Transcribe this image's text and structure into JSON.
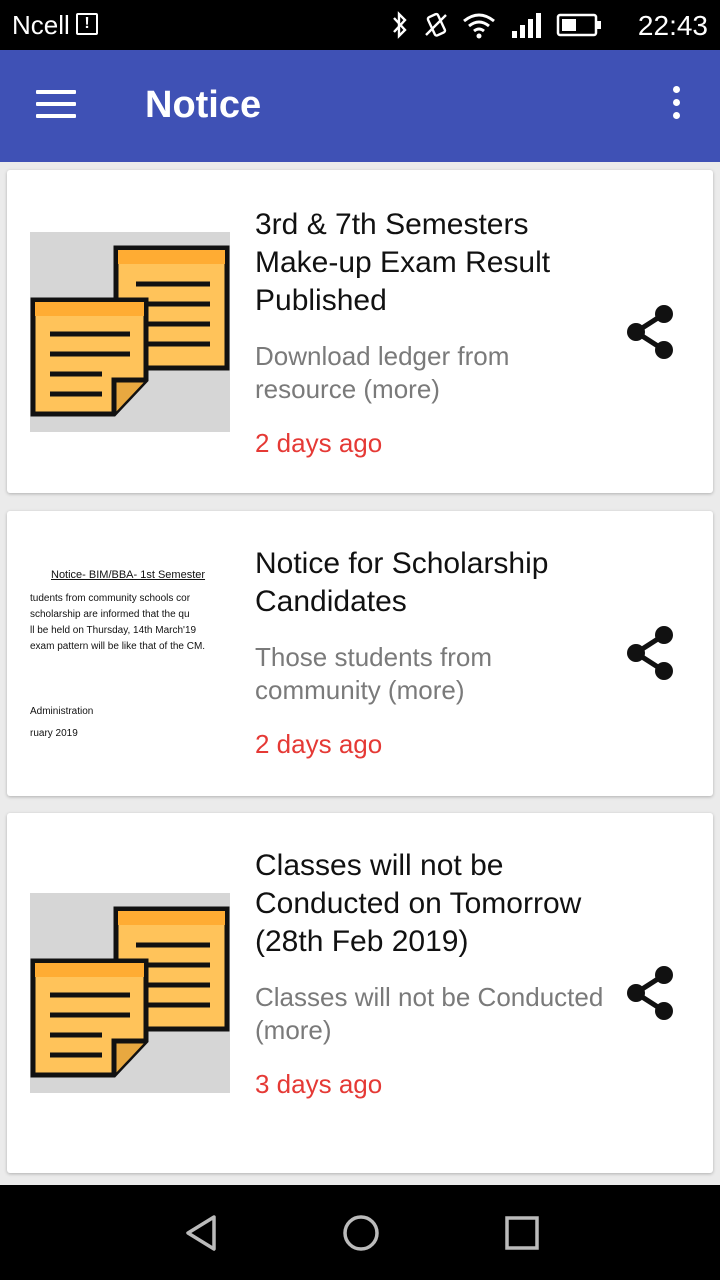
{
  "status_bar": {
    "carrier": "Ncell",
    "time": "22:43"
  },
  "app_bar": {
    "title": "Notice"
  },
  "notices": [
    {
      "title": "3rd & 7th Semesters Make-up Exam Result Published",
      "summary": "Download ledger from resource  (more)",
      "time": "2 days ago"
    },
    {
      "title": "Notice for Scholarship Candidates",
      "summary": "Those students from community  (more)",
      "time": "2 days ago",
      "thumbnail_text": {
        "heading": "Notice- BIM/BBA- 1st Semester",
        "lines": [
          "tudents from community schools cor",
          "scholarship are informed that the qu",
          "ll be held on Thursday, 14th March'19",
          "exam pattern will be like that of the CM."
        ],
        "signature": "Administration",
        "date": "ruary 2019"
      }
    },
    {
      "title": "Classes will not be Conducted on Tomorrow (28th Feb 2019)",
      "summary": "Classes will not be Conducted  (more)",
      "time": "3 days ago"
    }
  ],
  "colors": {
    "app_bar": "#3f51b5",
    "timestamp": "#e53935",
    "note_fill": "#ffc35a"
  }
}
